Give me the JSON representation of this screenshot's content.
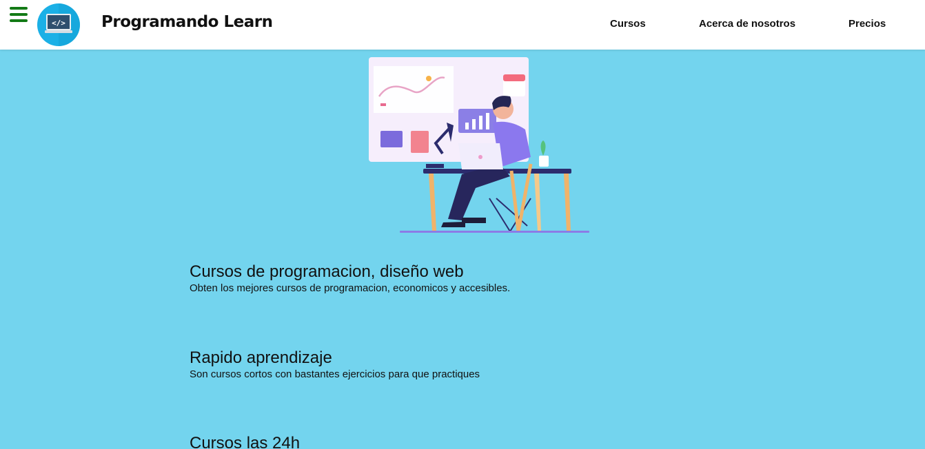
{
  "header": {
    "brand": "Programando Learn",
    "nav": [
      {
        "label": "Cursos"
      },
      {
        "label": "Acerca de nosotros"
      },
      {
        "label": "Precios"
      }
    ],
    "menu_icon": "hamburger-icon",
    "logo_icon": "code-monitor-icon"
  },
  "hero": {
    "illustration": "person-working-at-desk-illustration"
  },
  "features": [
    {
      "title": "Cursos de programacion, diseño web",
      "text": "Obten los mejores cursos de programacion, economicos y accesibles."
    },
    {
      "title": "Rapido aprendizaje",
      "text": "Son cursos cortos con bastantes ejercicios para que practiques"
    },
    {
      "title": "Cursos las 24h",
      "text": ""
    }
  ],
  "colors": {
    "background": "#73d4ee",
    "header_bg": "#ffffff",
    "menu_icon": "#137a16",
    "logo_circle": "#1bb0e6"
  }
}
